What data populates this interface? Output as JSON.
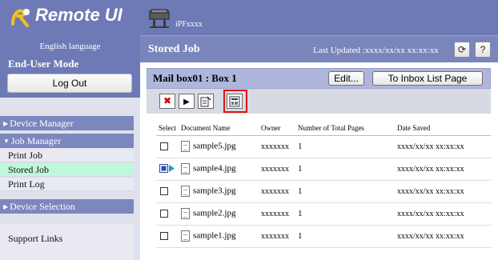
{
  "app": {
    "logo_text": "Remote UI",
    "language_label": "English language"
  },
  "header": {
    "printer_name": "iPFxxxx",
    "page_title": "Stored Job",
    "last_updated": "Last Updated :xxxx/xx/xx xx:xx:xx",
    "refresh_icon": "refresh-icon",
    "help_label": "?"
  },
  "sidebar": {
    "mode_label": "End-User Mode",
    "logout_label": "Log Out",
    "device_manager": "Device Manager",
    "job_manager": "Job Manager",
    "job_items": [
      {
        "label": "Print Job",
        "active": false
      },
      {
        "label": "Stored Job",
        "active": true
      },
      {
        "label": "Print Log",
        "active": false
      }
    ],
    "device_selection": "Device Selection",
    "support_links": "Support Links"
  },
  "box": {
    "title": "Mail box01 : Box 1",
    "edit_label": "Edit...",
    "inbox_list_label": "To Inbox List Page"
  },
  "toolbar": {
    "icons": [
      "delete-icon",
      "print-icon",
      "edit-details-icon",
      "settings-details-icon"
    ],
    "highlighted": "settings-details-icon"
  },
  "table": {
    "headers": [
      "Select",
      "Document Name",
      "Owner",
      "Number of Total Pages",
      "Date Saved"
    ],
    "rows": [
      {
        "document_name": "sample5.jpg",
        "owner": "xxxxxxx",
        "pages": "1",
        "date_saved": "xxxx/xx/xx xx:xx:xx",
        "selected": false
      },
      {
        "document_name": "sample4.jpg",
        "owner": "xxxxxxx",
        "pages": "1",
        "date_saved": "xxxx/xx/xx xx:xx:xx",
        "selected": true
      },
      {
        "document_name": "sample3.jpg",
        "owner": "xxxxxxx",
        "pages": "1",
        "date_saved": "xxxx/xx/xx xx:xx:xx",
        "selected": false
      },
      {
        "document_name": "sample2.jpg",
        "owner": "xxxxxxx",
        "pages": "1",
        "date_saved": "xxxx/xx/xx xx:xx:xx",
        "selected": false
      },
      {
        "document_name": "sample1.jpg",
        "owner": "xxxxxxx",
        "pages": "1",
        "date_saved": "xxxx/xx/xx xx:xx:xx",
        "selected": false
      }
    ]
  },
  "colors": {
    "header_bg": "#6e7ab6",
    "sidebar_bg": "#dfe1ec",
    "active_item": "#bff7dc",
    "highlight_border": "#e01010"
  }
}
